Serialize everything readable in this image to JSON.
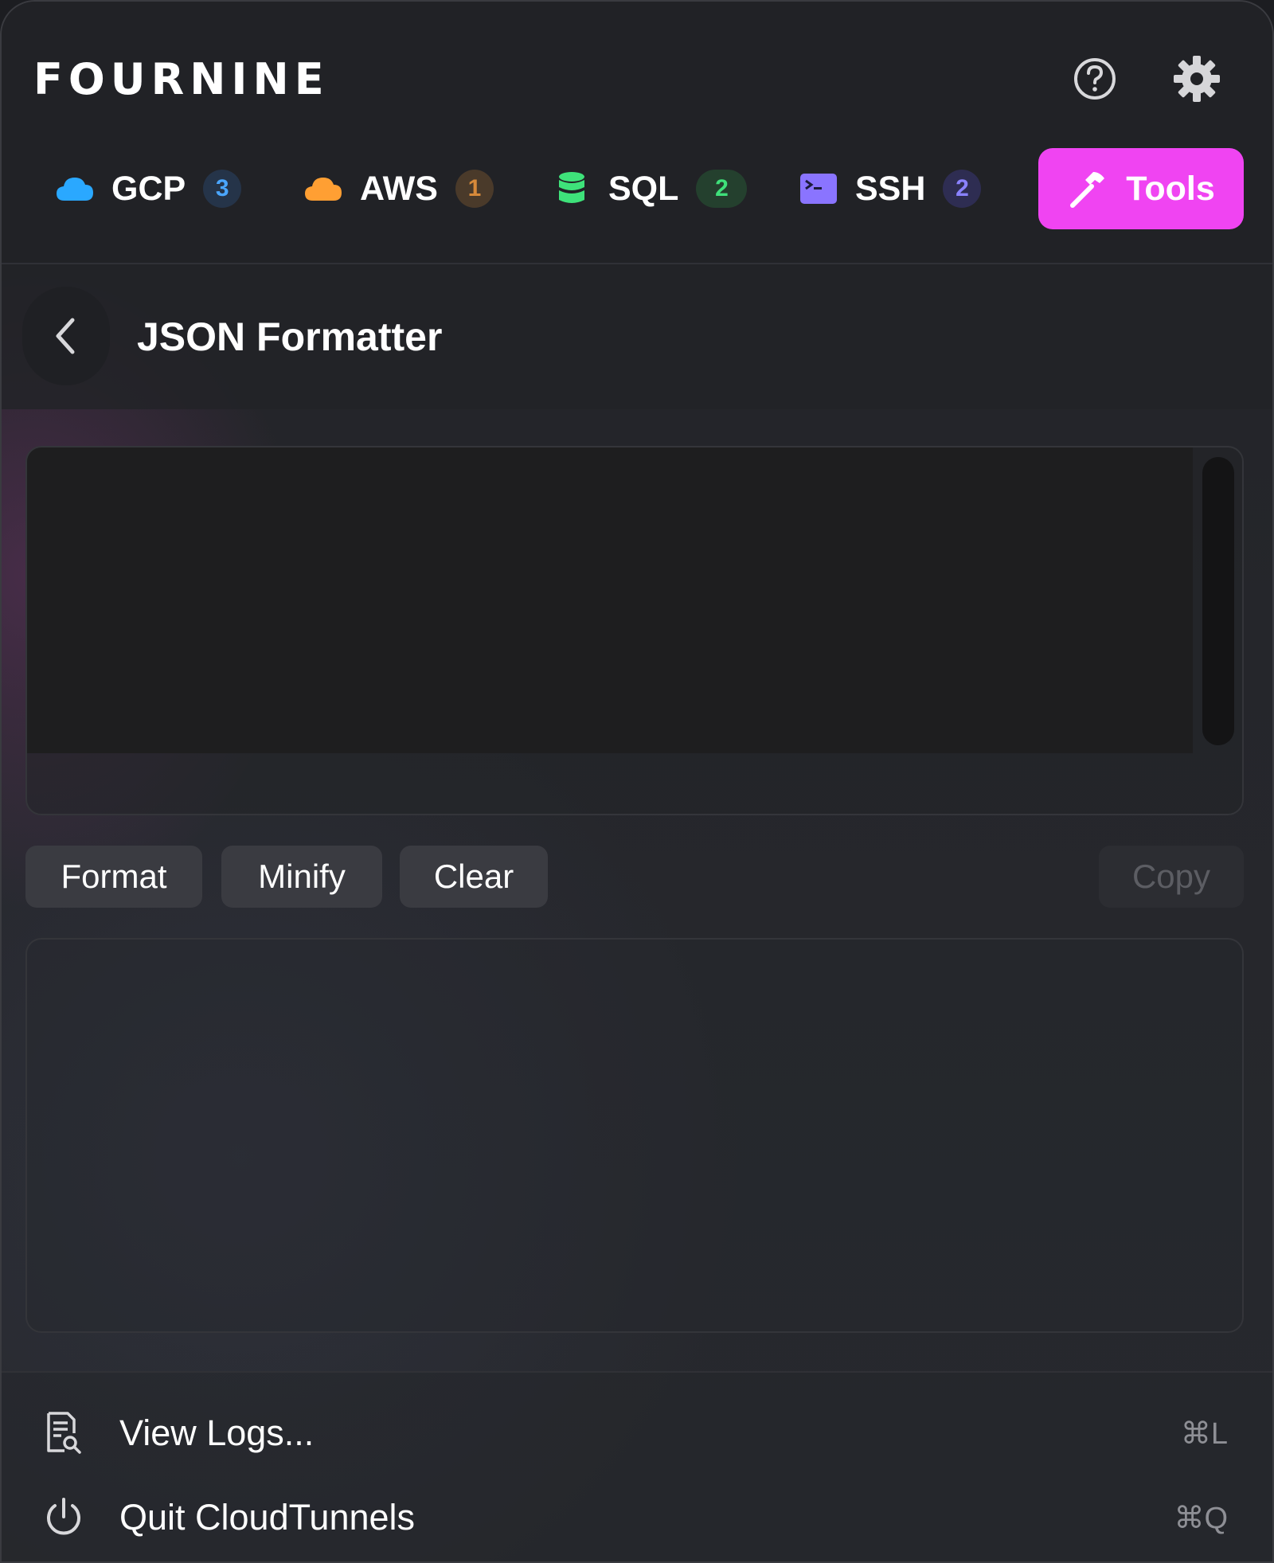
{
  "header": {
    "logo": "FOURNINE",
    "help_icon": "help-circle-icon",
    "settings_icon": "gear-icon"
  },
  "tabs": [
    {
      "label": "GCP",
      "badge": "3",
      "icon": "cloud-icon",
      "color": "#2aa8ff"
    },
    {
      "label": "AWS",
      "badge": "1",
      "icon": "cloud-icon",
      "color": "#ff9f33"
    },
    {
      "label": "SQL",
      "badge": "2",
      "icon": "database-icon",
      "color": "#3ee27a"
    },
    {
      "label": "SSH",
      "badge": "2",
      "icon": "terminal-icon",
      "color": "#8a74ff"
    },
    {
      "label": "Tools",
      "icon": "hammer-icon",
      "color": "#f044f2",
      "active": true
    }
  ],
  "tool": {
    "title": "JSON Formatter",
    "input_value": "",
    "output_value": ""
  },
  "actions": {
    "format": "Format",
    "minify": "Minify",
    "clear": "Clear",
    "copy": "Copy"
  },
  "footer": {
    "logs_label": "View Logs...",
    "logs_shortcut": "⌘L",
    "quit_label": "Quit CloudTunnels",
    "quit_shortcut": "⌘Q"
  }
}
